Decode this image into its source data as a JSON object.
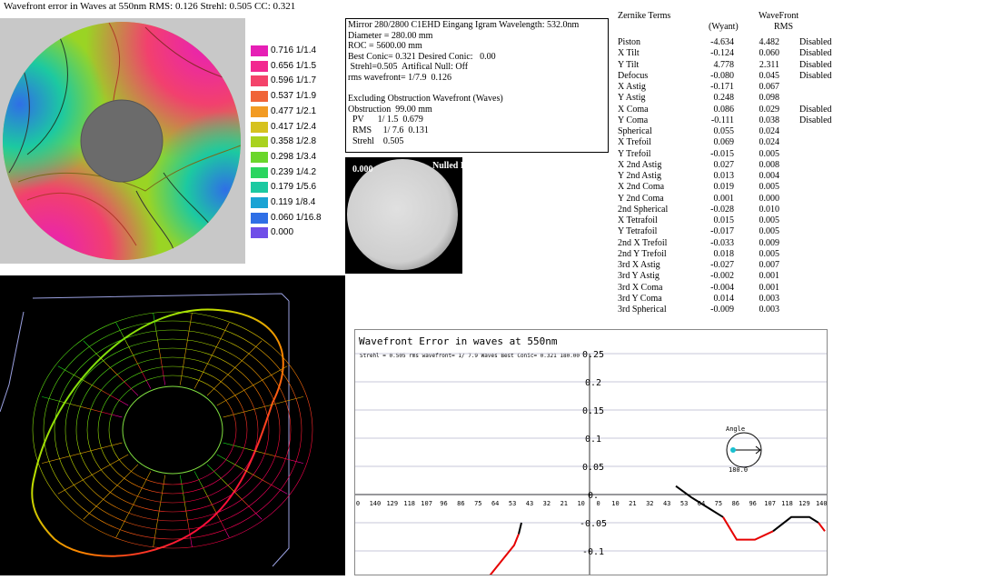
{
  "title": "Wavefront error in Waves at 550nm  RMS: 0.126 Strehl: 0.505 CC: 0.321",
  "legend": [
    {
      "label": "0.716 1/1.4",
      "color": "#e61fb5"
    },
    {
      "label": "0.656 1/1.5",
      "color": "#f2288f"
    },
    {
      "label": "0.596 1/1.7",
      "color": "#f4436a"
    },
    {
      "label": "0.537 1/1.9",
      "color": "#f06438"
    },
    {
      "label": "0.477 1/2.1",
      "color": "#f29b23"
    },
    {
      "label": "0.417 1/2.4",
      "color": "#d6c21e"
    },
    {
      "label": "0.358 1/2.8",
      "color": "#a9d21f"
    },
    {
      "label": "0.298 1/3.4",
      "color": "#6ad62b"
    },
    {
      "label": "0.239 1/4.2",
      "color": "#2bd55f"
    },
    {
      "label": "0.179 1/5.6",
      "color": "#1cc9a1"
    },
    {
      "label": "0.119 1/8.4",
      "color": "#1aa3d4"
    },
    {
      "label": "0.060 1/16.8",
      "color": "#2f6fe6"
    },
    {
      "label": "0.000",
      "color": "#6f4ee8"
    }
  ],
  "info": {
    "lines": [
      "Mirror 280/2800 C1EHD Eingang Igram Wavelength: 532.0nm",
      "Diameter = 280.00 mm",
      "ROC = 5600.00 mm",
      "Best Conic= 0.321 Desired Conic:   0.00",
      " Strehl=0.505  Artifical Null: Off",
      "rms wavefront= 1/7.9  0.126",
      "",
      "Excluding Obstruction Wavefront (Waves)",
      "Obstruction  99.00 mm",
      "  PV      1/ 1.5  0.679",
      "  RMS     1/ 7.6  0.131",
      "  Strehl    0.505"
    ]
  },
  "nulled": {
    "left": "0.000",
    "right": "Nulled I"
  },
  "zernike": {
    "header": "Zernike Terms",
    "header_wf": "WaveFront",
    "sub_wyant": "(Wyant)",
    "sub_rms": "RMS",
    "rows": [
      {
        "name": "Piston",
        "wyant": "-4.634",
        "rms": "4.482",
        "status": "Disabled"
      },
      {
        "name": "X Tilt",
        "wyant": "-0.124",
        "rms": "0.060",
        "status": "Disabled"
      },
      {
        "name": "Y Tilt",
        "wyant": "4.778",
        "rms": "2.311",
        "status": "Disabled"
      },
      {
        "name": "Defocus",
        "wyant": "-0.080",
        "rms": "0.045",
        "status": "Disabled"
      },
      {
        "name": "X Astig",
        "wyant": "-0.171",
        "rms": "0.067",
        "status": ""
      },
      {
        "name": "Y Astig",
        "wyant": "0.248",
        "rms": "0.098",
        "status": ""
      },
      {
        "name": "X Coma",
        "wyant": "0.086",
        "rms": "0.029",
        "status": "Disabled"
      },
      {
        "name": "Y Coma",
        "wyant": "-0.111",
        "rms": "0.038",
        "status": "Disabled"
      },
      {
        "name": "Spherical",
        "wyant": "0.055",
        "rms": "0.024",
        "status": ""
      },
      {
        "name": "X Trefoil",
        "wyant": "0.069",
        "rms": "0.024",
        "status": ""
      },
      {
        "name": "Y Trefoil",
        "wyant": "-0.015",
        "rms": "0.005",
        "status": ""
      },
      {
        "name": "X 2nd Astig",
        "wyant": "0.027",
        "rms": "0.008",
        "status": ""
      },
      {
        "name": "Y 2nd Astig",
        "wyant": "0.013",
        "rms": "0.004",
        "status": ""
      },
      {
        "name": "X 2nd Coma",
        "wyant": "0.019",
        "rms": "0.005",
        "status": ""
      },
      {
        "name": "Y 2nd Coma",
        "wyant": "0.001",
        "rms": "0.000",
        "status": ""
      },
      {
        "name": "2nd Spherical",
        "wyant": "-0.028",
        "rms": "0.010",
        "status": ""
      },
      {
        "name": "X Tetrafoil",
        "wyant": "0.015",
        "rms": "0.005",
        "status": ""
      },
      {
        "name": "Y Tetrafoil",
        "wyant": "-0.017",
        "rms": "0.005",
        "status": ""
      },
      {
        "name": "2nd X Trefoil",
        "wyant": "-0.033",
        "rms": "0.009",
        "status": ""
      },
      {
        "name": "2nd Y Trefoil",
        "wyant": "0.018",
        "rms": "0.005",
        "status": ""
      },
      {
        "name": "3rd X Astig",
        "wyant": "-0.027",
        "rms": "0.007",
        "status": ""
      },
      {
        "name": "3rd Y Astig",
        "wyant": "-0.002",
        "rms": "0.001",
        "status": ""
      },
      {
        "name": "3rd X Coma",
        "wyant": "-0.004",
        "rms": "0.001",
        "status": ""
      },
      {
        "name": "3rd Y Coma",
        "wyant": "0.014",
        "rms": "0.003",
        "status": ""
      },
      {
        "name": "3rd Spherical",
        "wyant": "-0.009",
        "rms": "0.003",
        "status": ""
      }
    ]
  },
  "profile": {
    "title": "Wavefront Error in waves at 550nm",
    "subtitle": "Strehl = 0.505 rms wavefront= 1/ 7.9 Waves Best Conic= 0.321 180.00",
    "angle_label": "Angle",
    "angle_value": "180.0",
    "ylim": [
      -0.15,
      0.25
    ],
    "yticks": [
      "0.25",
      "0.2",
      "0.15",
      "0.1",
      "0.05",
      "0.",
      "-0.05",
      "-0.1"
    ],
    "xticks": [
      "0",
      "140",
      "129",
      "118",
      "107",
      "96",
      "86",
      "75",
      "64",
      "53",
      "43",
      "32",
      "21",
      "10",
      "0",
      "10",
      "21",
      "32",
      "43",
      "53",
      "64",
      "75",
      "86",
      "96",
      "107",
      "118",
      "129",
      "140"
    ],
    "colors": {
      "negative": "#e60000",
      "positive": "#000000",
      "grid": "#b4b4cc",
      "angle_dot": "#19c0d0"
    }
  }
}
